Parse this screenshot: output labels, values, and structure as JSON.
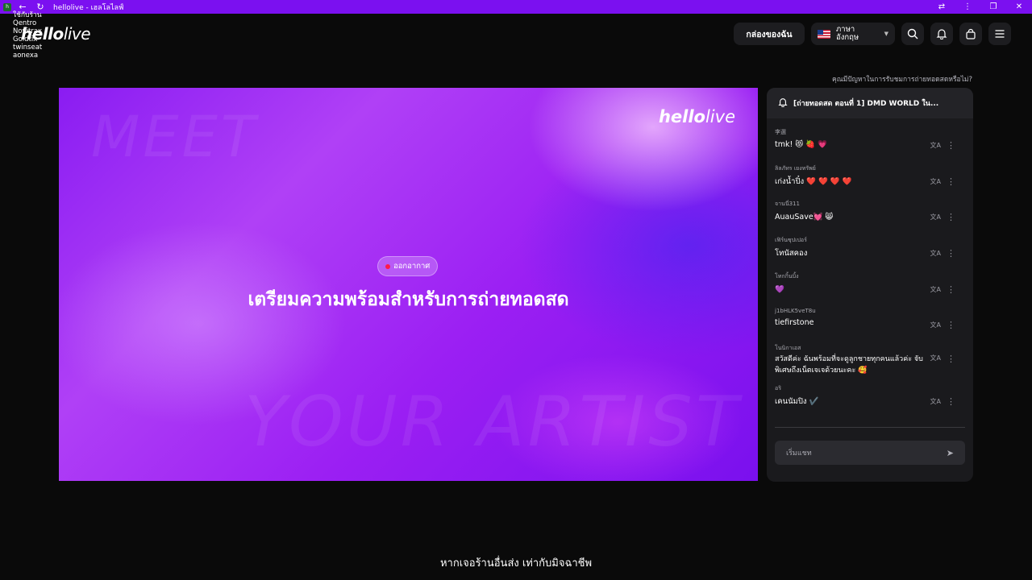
{
  "browser": {
    "title": "hellolive - เฮลโลไลฟ์",
    "back_icon": "←",
    "reload_icon": "↻",
    "right_icons": [
      "translate",
      "⋮",
      "❐",
      "✕"
    ]
  },
  "overlay_lines": [
    "ใช้กับร้าน",
    "Qentro",
    "Novitrax",
    "Goldtix",
    "twinseat",
    "aonexa"
  ],
  "header": {
    "logo_bold": "hello",
    "logo_light": "live",
    "mybox_label": "กล่องของฉัน",
    "language_label": "ภาษาอังกฤษ",
    "icons": [
      "search-icon",
      "bell-icon",
      "bag-icon",
      "menu-icon"
    ]
  },
  "help_text": "คุณมีปัญหาในการรับชมการถ่ายทอดสดหรือไม่?",
  "player": {
    "logo_bold": "hello",
    "logo_light": "live",
    "bg_word_1": "MEET",
    "bg_word_2": "YOUR ARTIST",
    "live_badge": "ออกอากาศ",
    "headline": "เตรียมความพร้อมสำหรับการถ่ายทอดสด"
  },
  "chat": {
    "title": "[ถ่ายทอดสด ตอนที่ 1] DMD WORLD ใน...",
    "messages": [
      {
        "user": "李選",
        "text": "tmk! 😻 🍓 💗"
      },
      {
        "user": "ลิลภัทร เยงทรัพย์",
        "text": "เก่งน้ำปิ๋ง ❤️ ❤️ ❤️ ❤️"
      },
      {
        "user": "จานนี่311",
        "text": "AuauSave💓 😸"
      },
      {
        "user": "เฟิร์นซุปเปอร์",
        "text": "โทนัสคอง"
      },
      {
        "user": "โทกกิ้นบิ้ง",
        "text": "💜"
      },
      {
        "user": "j1bHLK5veT8u",
        "text": "tiefirstone"
      },
      {
        "user": "โนนิกาเอส",
        "text": "สวัสดีค่ะ ฉันพร้อมที่จะดูลูกชายทุกคนแล้วค่ะ จับพิเศษถึงเน็ตเจเจด้วยนะคะ 🥰"
      },
      {
        "user": "อริ",
        "text": "เคนนัมปิง ✔️"
      }
    ],
    "input_placeholder": "เริ่มแชท",
    "send_icon": "➤",
    "translate_icon": "文A",
    "more_icon": "⋮"
  },
  "subtitle": "หากเจอร้านอื่นส่ง เท่ากับมิจฉาชีพ",
  "colors": {
    "browser_bar": "#7b10f0",
    "player_base": "#8a1cf2",
    "chat_bg": "#1a1a1d",
    "live_dot": "#ff1a4a"
  }
}
